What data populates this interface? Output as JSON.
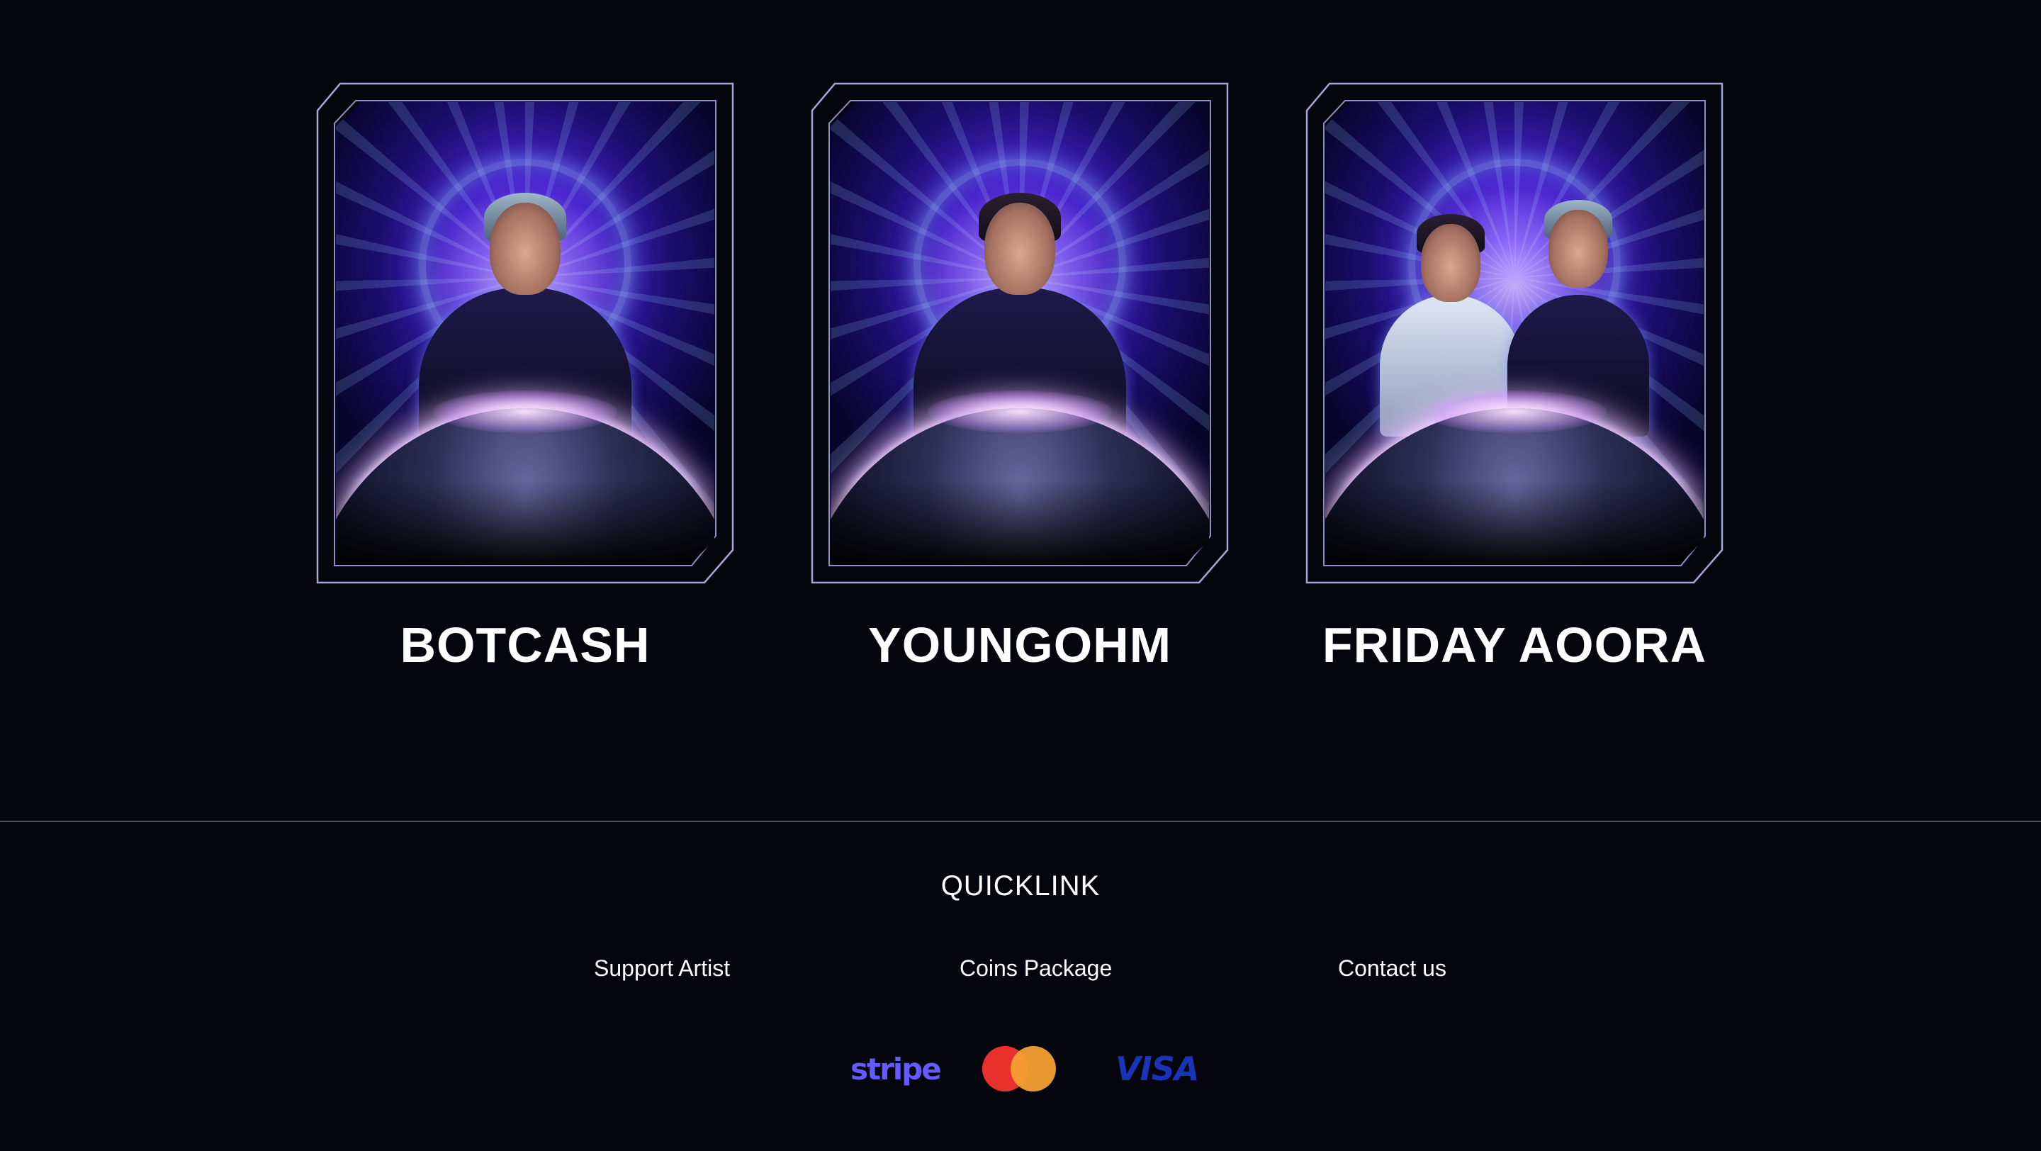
{
  "artists": [
    {
      "name": "BOTCASH"
    },
    {
      "name": "YOUNGOHM"
    },
    {
      "name": "FRIDAY AOORA"
    }
  ],
  "footer": {
    "title": "QUICKLINK",
    "links": [
      "Support Artist",
      "Coins Package",
      "Contact us"
    ],
    "payments": {
      "stripe": "stripe",
      "visa": "VISA",
      "mastercard": "mastercard-logo"
    }
  },
  "colors": {
    "background": "#05050d",
    "frame": "#a7a6d8",
    "divider": "#4f5166",
    "stripe": "#635bff",
    "visa": "#1a34b8",
    "mastercard_red": "#e8312c",
    "mastercard_orange": "#f5a033"
  }
}
